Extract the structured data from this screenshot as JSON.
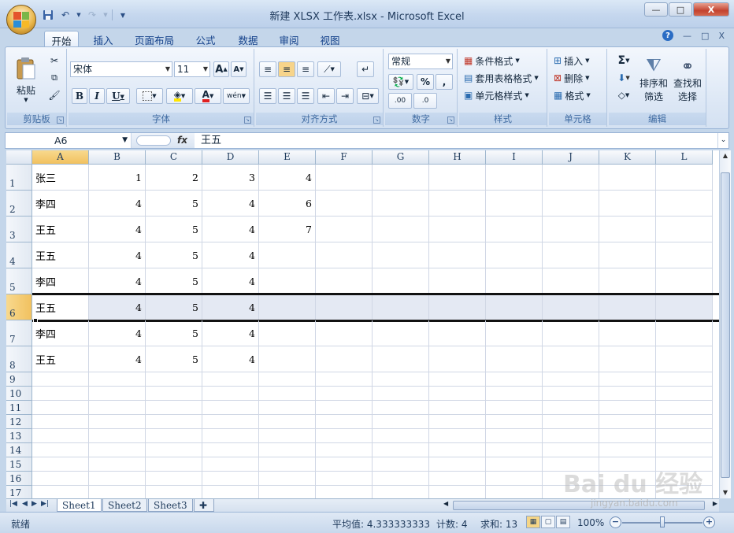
{
  "window": {
    "title": "新建 XLSX 工作表.xlsx - Microsoft Excel",
    "controls": {
      "minimize": "—",
      "restore": "□",
      "close": "X"
    }
  },
  "quick_access": {
    "save_icon": "save-icon",
    "undo_icon": "undo-icon",
    "redo_icon": "redo-icon",
    "customize_icon": "chevron-down-icon"
  },
  "tabs": [
    "开始",
    "插入",
    "页面布局",
    "公式",
    "数据",
    "审阅",
    "视图"
  ],
  "active_tab": "开始",
  "ribbon_right": {
    "help": "?",
    "minimize": "—",
    "restore": "□",
    "close": "X"
  },
  "ribbon": {
    "clipboard": {
      "label": "剪贴板",
      "paste": "粘贴"
    },
    "font": {
      "label": "字体",
      "font_name": "宋体",
      "font_size": "11",
      "grow": "A",
      "shrink": "A",
      "bold": "B",
      "italic": "I",
      "underline": "U",
      "phonetic": "wén"
    },
    "alignment": {
      "label": "对齐方式"
    },
    "number": {
      "label": "数字",
      "format": "常规",
      "percent": "%",
      "comma": ",",
      "inc_decimal": ".00",
      "dec_decimal": ".0"
    },
    "styles": {
      "label": "样式",
      "conditional": "条件格式",
      "table_format": "套用表格格式",
      "cell_styles": "单元格样式"
    },
    "cells": {
      "label": "单元格",
      "insert": "插入",
      "delete": "删除",
      "format": "格式"
    },
    "editing": {
      "label": "编辑",
      "sort": "排序和",
      "sort2": "筛选",
      "find": "查找和",
      "find2": "选择",
      "sum": "Σ"
    }
  },
  "formula_bar": {
    "name_box": "A6",
    "fx": "fx",
    "content": "王五"
  },
  "columns": [
    "A",
    "B",
    "C",
    "D",
    "E",
    "F",
    "G",
    "H",
    "I",
    "J",
    "K",
    "L"
  ],
  "selected_column": "A",
  "rows": [
    {
      "n": "1",
      "cells": [
        "张三",
        "1",
        "2",
        "3",
        "4",
        "",
        "",
        "",
        "",
        "",
        "",
        ""
      ]
    },
    {
      "n": "2",
      "cells": [
        "李四",
        "4",
        "5",
        "4",
        "6",
        "",
        "",
        "",
        "",
        "",
        "",
        ""
      ]
    },
    {
      "n": "3",
      "cells": [
        "王五",
        "4",
        "5",
        "4",
        "7",
        "",
        "",
        "",
        "",
        "",
        "",
        ""
      ]
    },
    {
      "n": "4",
      "cells": [
        "王五",
        "4",
        "5",
        "4",
        "",
        "",
        "",
        "",
        "",
        "",
        "",
        ""
      ]
    },
    {
      "n": "5",
      "cells": [
        "李四",
        "4",
        "5",
        "4",
        "",
        "",
        "",
        "",
        "",
        "",
        "",
        ""
      ]
    },
    {
      "n": "6",
      "cells": [
        "王五",
        "4",
        "5",
        "4",
        "",
        "",
        "",
        "",
        "",
        "",
        "",
        ""
      ],
      "selected": true
    },
    {
      "n": "7",
      "cells": [
        "李四",
        "4",
        "5",
        "4",
        "",
        "",
        "",
        "",
        "",
        "",
        "",
        ""
      ]
    },
    {
      "n": "8",
      "cells": [
        "王五",
        "4",
        "5",
        "4",
        "",
        "",
        "",
        "",
        "",
        "",
        "",
        ""
      ]
    },
    {
      "n": "9",
      "cells": [
        "",
        "",
        "",
        "",
        "",
        "",
        "",
        "",
        "",
        "",
        "",
        ""
      ]
    },
    {
      "n": "10",
      "cells": [
        "",
        "",
        "",
        "",
        "",
        "",
        "",
        "",
        "",
        "",
        "",
        ""
      ]
    },
    {
      "n": "11",
      "cells": [
        "",
        "",
        "",
        "",
        "",
        "",
        "",
        "",
        "",
        "",
        "",
        ""
      ]
    },
    {
      "n": "12",
      "cells": [
        "",
        "",
        "",
        "",
        "",
        "",
        "",
        "",
        "",
        "",
        "",
        ""
      ]
    },
    {
      "n": "13",
      "cells": [
        "",
        "",
        "",
        "",
        "",
        "",
        "",
        "",
        "",
        "",
        "",
        ""
      ]
    },
    {
      "n": "14",
      "cells": [
        "",
        "",
        "",
        "",
        "",
        "",
        "",
        "",
        "",
        "",
        "",
        ""
      ]
    },
    {
      "n": "15",
      "cells": [
        "",
        "",
        "",
        "",
        "",
        "",
        "",
        "",
        "",
        "",
        "",
        ""
      ]
    },
    {
      "n": "16",
      "cells": [
        "",
        "",
        "",
        "",
        "",
        "",
        "",
        "",
        "",
        "",
        "",
        ""
      ]
    },
    {
      "n": "17",
      "cells": [
        "",
        "",
        "",
        "",
        "",
        "",
        "",
        "",
        "",
        "",
        "",
        ""
      ]
    }
  ],
  "sheets": [
    "Sheet1",
    "Sheet2",
    "Sheet3"
  ],
  "active_sheet": "Sheet1",
  "status": {
    "ready": "就绪",
    "average": "平均值: 4.333333333",
    "count": "计数: 4",
    "sum": "求和: 13",
    "zoom": "100%"
  },
  "watermark": {
    "text": "Bai du 经验",
    "url": "jingyan.baidu.com"
  }
}
